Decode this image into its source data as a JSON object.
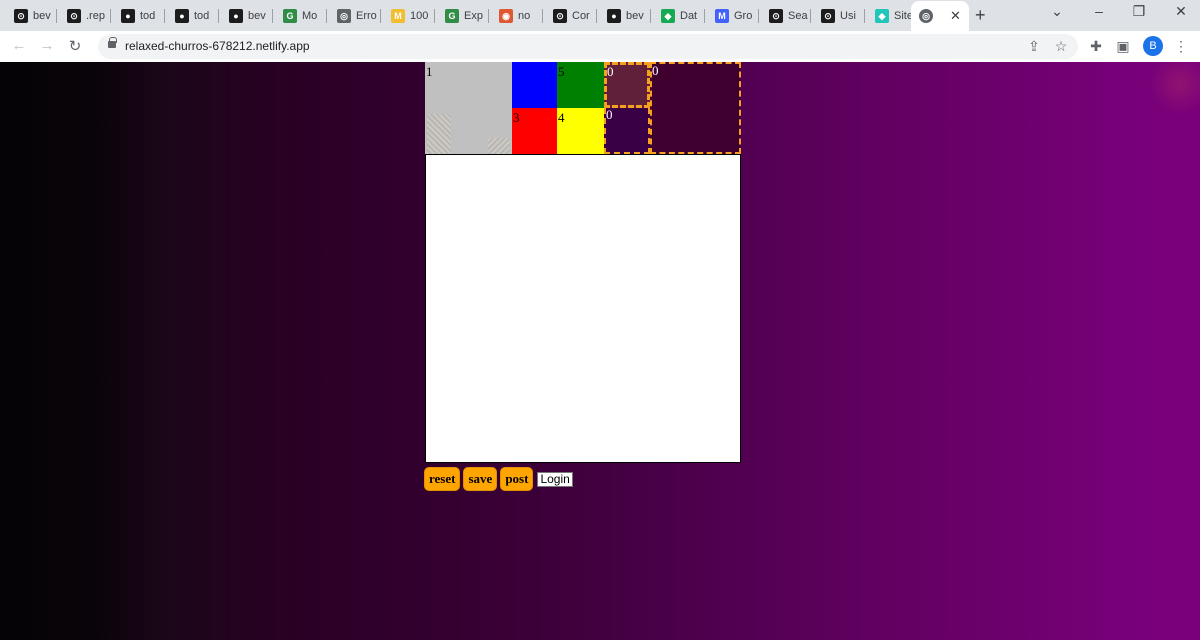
{
  "browser": {
    "tabs": [
      {
        "title": "bev",
        "icon": "replit-icon",
        "color": "#1c1c1c",
        "glyph": "⊙"
      },
      {
        "title": ".rep",
        "icon": "replit-icon",
        "color": "#1c1c1c",
        "glyph": "⊙"
      },
      {
        "title": "tod",
        "icon": "github-icon",
        "color": "#1c1c1c",
        "glyph": "●"
      },
      {
        "title": "tod",
        "icon": "github-icon",
        "color": "#1c1c1c",
        "glyph": "●"
      },
      {
        "title": "bev",
        "icon": "github-icon",
        "color": "#1c1c1c",
        "glyph": "●"
      },
      {
        "title": "Mo",
        "icon": "geeksforgeeks-icon",
        "color": "#2f8d46",
        "glyph": "G"
      },
      {
        "title": "Erro",
        "icon": "globe-icon",
        "color": "#5f6368",
        "glyph": "◎"
      },
      {
        "title": "100",
        "icon": "fcc-icon",
        "color": "#f1be32",
        "glyph": "M"
      },
      {
        "title": "Exp",
        "icon": "geeksforgeeks-icon",
        "color": "#2f8d46",
        "glyph": "G"
      },
      {
        "title": "no",
        "icon": "duckduckgo-icon",
        "color": "#de5833",
        "glyph": "◉"
      },
      {
        "title": "Cor",
        "icon": "replit-icon",
        "color": "#1c1c1c",
        "glyph": "⊙"
      },
      {
        "title": "bev",
        "icon": "github-icon",
        "color": "#1c1c1c",
        "glyph": "●"
      },
      {
        "title": "Dat",
        "icon": "mongodb-icon",
        "color": "#13aa52",
        "glyph": "◆"
      },
      {
        "title": "Gro",
        "icon": "miro-icon",
        "color": "#4262ff",
        "glyph": "M"
      },
      {
        "title": "Sea",
        "icon": "replit-icon",
        "color": "#1c1c1c",
        "glyph": "⊙"
      },
      {
        "title": "Usi",
        "icon": "replit-icon",
        "color": "#1c1c1c",
        "glyph": "⊙"
      },
      {
        "title": "Site",
        "icon": "netlify-icon",
        "color": "#20c6b7",
        "glyph": "◆"
      }
    ],
    "active_tab_icon": "globe-icon",
    "url": "relaxed-churros-678212.netlify.app",
    "profile_initial": "B"
  },
  "grid": {
    "gray_cell": "1",
    "blue_cell": "",
    "green_cell": "5",
    "red_cell": "3",
    "yellow_cell": "4",
    "drop_cell_1": "0",
    "drop_cell_2": "0",
    "drop_cell_3": "0"
  },
  "actions": {
    "reset_label": "reset",
    "save_label": "save",
    "post_label": "post",
    "login_label": "Login"
  },
  "colors": {
    "button": "#ffa500",
    "dashed_border": "#f5a020",
    "page_gradient_end": "#7a007b"
  }
}
